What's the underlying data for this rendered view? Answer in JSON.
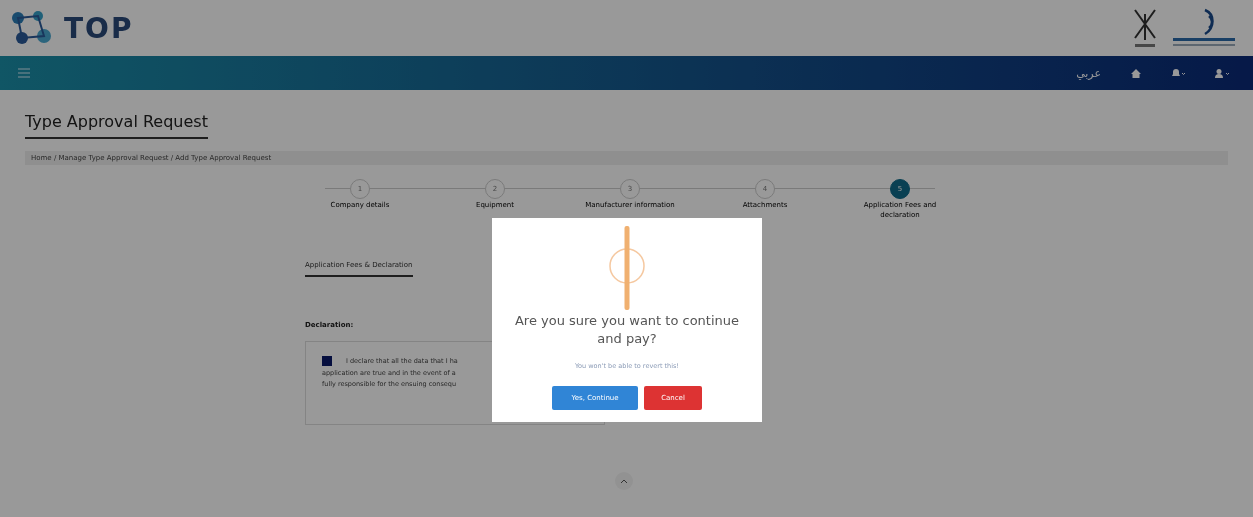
{
  "header": {
    "logo_text": "TOP"
  },
  "navbar": {
    "language": "عربي"
  },
  "page": {
    "title": "Type Approval Request",
    "breadcrumb": "Home / Manage Type Approval Request / Add Type Approval Request"
  },
  "stepper": [
    {
      "number": "1",
      "label": "Company details",
      "selected": false
    },
    {
      "number": "2",
      "label": "Equipment",
      "selected": false
    },
    {
      "number": "3",
      "label": "Manufacturer information",
      "selected": false
    },
    {
      "number": "4",
      "label": "Attachments",
      "selected": false
    },
    {
      "number": "5",
      "label": "Application Fees and declaration",
      "selected": true
    }
  ],
  "section": {
    "title": "Application Fees & Declaration",
    "declaration_label": "Declaration:",
    "declaration_checked": true,
    "declaration_lines": [
      "I declare that all the data that I ha",
      "application are true and in the event of a",
      "fully responsible for the ensuing consequ"
    ]
  },
  "dialog": {
    "title": "Are you sure you want to continue and pay?",
    "text": "You won't be able to revert this!",
    "buttons": [
      {
        "label": "Yes, Continue",
        "kind": "confirm"
      },
      {
        "label": "Cancel",
        "kind": "cancel"
      }
    ]
  }
}
